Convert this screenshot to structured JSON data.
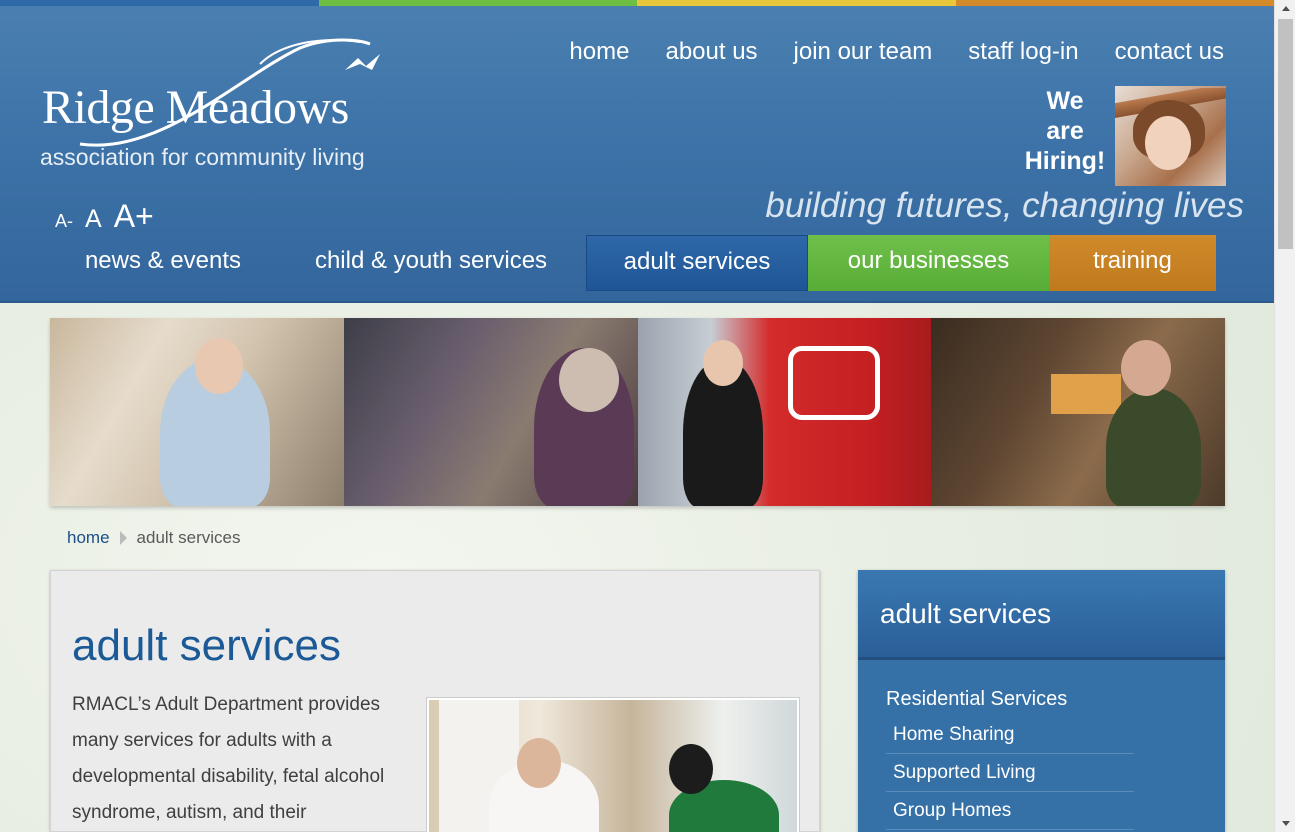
{
  "colors": {
    "strip": [
      "#2e6aa8",
      "#6cbf43",
      "#e8c83a",
      "#d48a28"
    ],
    "header_blue": "#3d73a8",
    "nav_active": "#1f5596",
    "nav_green": "#58ad36",
    "nav_orange": "#bf7a1e"
  },
  "logo": {
    "main": "Ridge Meadows",
    "sub": "association for community living"
  },
  "topnav": [
    {
      "label": "home"
    },
    {
      "label": "about us"
    },
    {
      "label": "join our team"
    },
    {
      "label": "staff log-in"
    },
    {
      "label": "contact us"
    }
  ],
  "font_controls": {
    "small": "A-",
    "normal": "A",
    "large": "A+"
  },
  "hiring": {
    "line1": "We",
    "line2": "are",
    "line3": "Hiring!"
  },
  "tagline": "building futures, changing lives",
  "mainnav": {
    "news": "news & events",
    "child": "child & youth services",
    "adult": "adult services",
    "business": "our businesses",
    "training": "training"
  },
  "breadcrumb": {
    "home": "home",
    "current": "adult services"
  },
  "content": {
    "title": "adult services",
    "body": "RMACL’s Adult Department provides many services for adults with a developmental disability, fetal alcohol syndrome, autism, and their"
  },
  "sidebar": {
    "title": "adult services",
    "section": "Residential Services",
    "items": [
      {
        "label": "Home Sharing"
      },
      {
        "label": "Supported Living"
      },
      {
        "label": "Group Homes"
      }
    ]
  }
}
